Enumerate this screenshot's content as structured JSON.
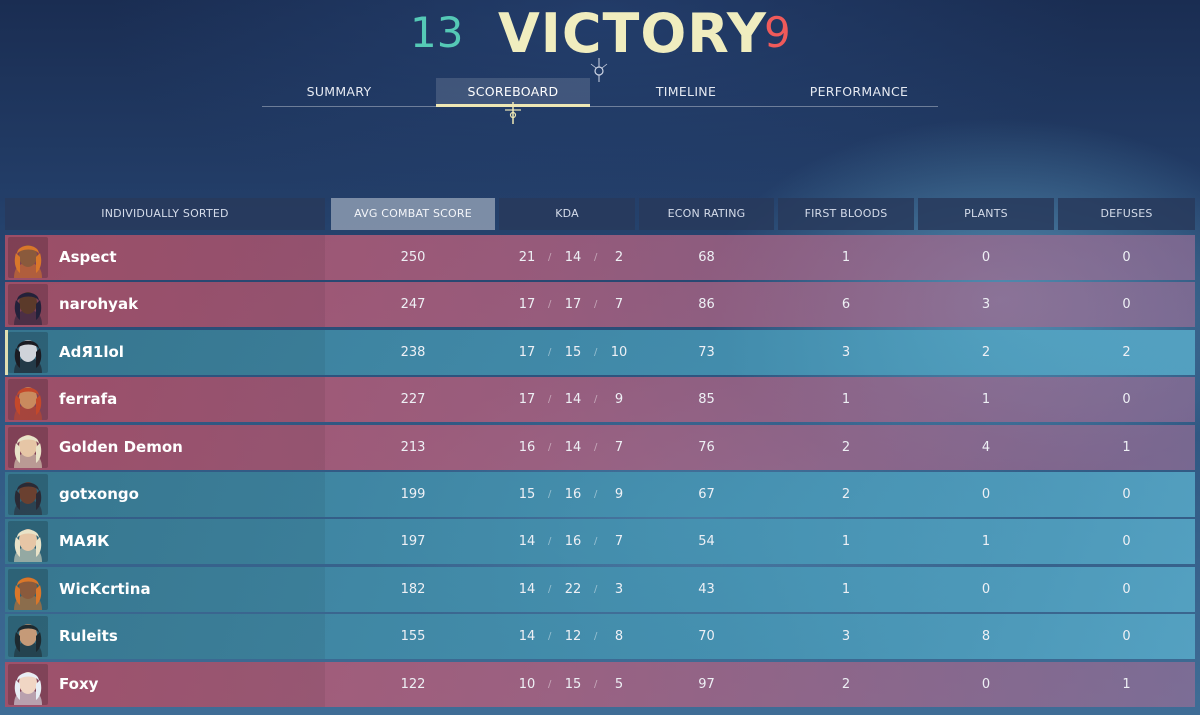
{
  "header": {
    "score_left": "13",
    "result": "VICTORY",
    "score_right": "9",
    "colors": {
      "ally": "#55c9b6",
      "enemy": "#ef5a5a",
      "result": "#f0edbf"
    }
  },
  "tabs": [
    {
      "label": "SUMMARY"
    },
    {
      "label": "SCOREBOARD"
    },
    {
      "label": "TIMELINE"
    },
    {
      "label": "PERFORMANCE"
    }
  ],
  "active_tab": "SCOREBOARD",
  "table": {
    "columns": [
      "INDIVIDUALLY SORTED",
      "AVG COMBAT SCORE",
      "KDA",
      "ECON RATING",
      "FIRST BLOODS",
      "PLANTS",
      "DEFUSES"
    ],
    "sorted_by": "AVG COMBAT SCORE",
    "kda_separator": "/",
    "rows": [
      {
        "name": "Aspect",
        "team": "red",
        "acs": "250",
        "k": "21",
        "d": "14",
        "a": "2",
        "econ": "68",
        "fb": "1",
        "plants": "0",
        "defuses": "0"
      },
      {
        "name": "narohyak",
        "team": "red",
        "acs": "247",
        "k": "17",
        "d": "17",
        "a": "7",
        "econ": "86",
        "fb": "6",
        "plants": "3",
        "defuses": "0"
      },
      {
        "name": "AdЯ1lol",
        "team": "teal",
        "self": true,
        "acs": "238",
        "k": "17",
        "d": "15",
        "a": "10",
        "econ": "73",
        "fb": "3",
        "plants": "2",
        "defuses": "2"
      },
      {
        "name": "ferrafa",
        "team": "red",
        "acs": "227",
        "k": "17",
        "d": "14",
        "a": "9",
        "econ": "85",
        "fb": "1",
        "plants": "1",
        "defuses": "0"
      },
      {
        "name": "Golden Demon",
        "team": "red",
        "acs": "213",
        "k": "16",
        "d": "14",
        "a": "7",
        "econ": "76",
        "fb": "2",
        "plants": "4",
        "defuses": "1"
      },
      {
        "name": "gotxongo",
        "team": "teal",
        "acs": "199",
        "k": "15",
        "d": "16",
        "a": "9",
        "econ": "67",
        "fb": "2",
        "plants": "0",
        "defuses": "0"
      },
      {
        "name": "МАЯК",
        "team": "teal",
        "acs": "197",
        "k": "14",
        "d": "16",
        "a": "7",
        "econ": "54",
        "fb": "1",
        "plants": "1",
        "defuses": "0"
      },
      {
        "name": "WicKcrtina",
        "team": "teal",
        "acs": "182",
        "k": "14",
        "d": "22",
        "a": "3",
        "econ": "43",
        "fb": "1",
        "plants": "0",
        "defuses": "0"
      },
      {
        "name": "Ruleits",
        "team": "teal",
        "acs": "155",
        "k": "14",
        "d": "12",
        "a": "8",
        "econ": "70",
        "fb": "3",
        "plants": "8",
        "defuses": "0"
      },
      {
        "name": "Foxy",
        "team": "red",
        "acs": "122",
        "k": "10",
        "d": "15",
        "a": "5",
        "econ": "97",
        "fb": "2",
        "plants": "0",
        "defuses": "1"
      }
    ]
  },
  "avatars": [
    {
      "icon": "agent-portrait-icon",
      "skin": "#8a5a3c",
      "hair": "#d9772a"
    },
    {
      "icon": "agent-portrait-icon",
      "skin": "#5b3a2a",
      "hair": "#23213a"
    },
    {
      "icon": "agent-portrait-icon",
      "skin": "#cfd3da",
      "hair": "#1b1b22"
    },
    {
      "icon": "agent-portrait-icon",
      "skin": "#c98a5e",
      "hair": "#c4482a"
    },
    {
      "icon": "agent-portrait-icon",
      "skin": "#e6c6a6",
      "hair": "#e9e3c8"
    },
    {
      "icon": "agent-portrait-icon",
      "skin": "#6a4030",
      "hair": "#2a2a35"
    },
    {
      "icon": "agent-portrait-icon",
      "skin": "#e6c6a6",
      "hair": "#e9e3c8"
    },
    {
      "icon": "agent-portrait-icon",
      "skin": "#8a5a3c",
      "hair": "#d9772a"
    },
    {
      "icon": "agent-portrait-icon",
      "skin": "#c59a78",
      "hair": "#1d2a30"
    },
    {
      "icon": "agent-portrait-icon",
      "skin": "#f0d6c4",
      "hair": "#e8eef5"
    }
  ]
}
